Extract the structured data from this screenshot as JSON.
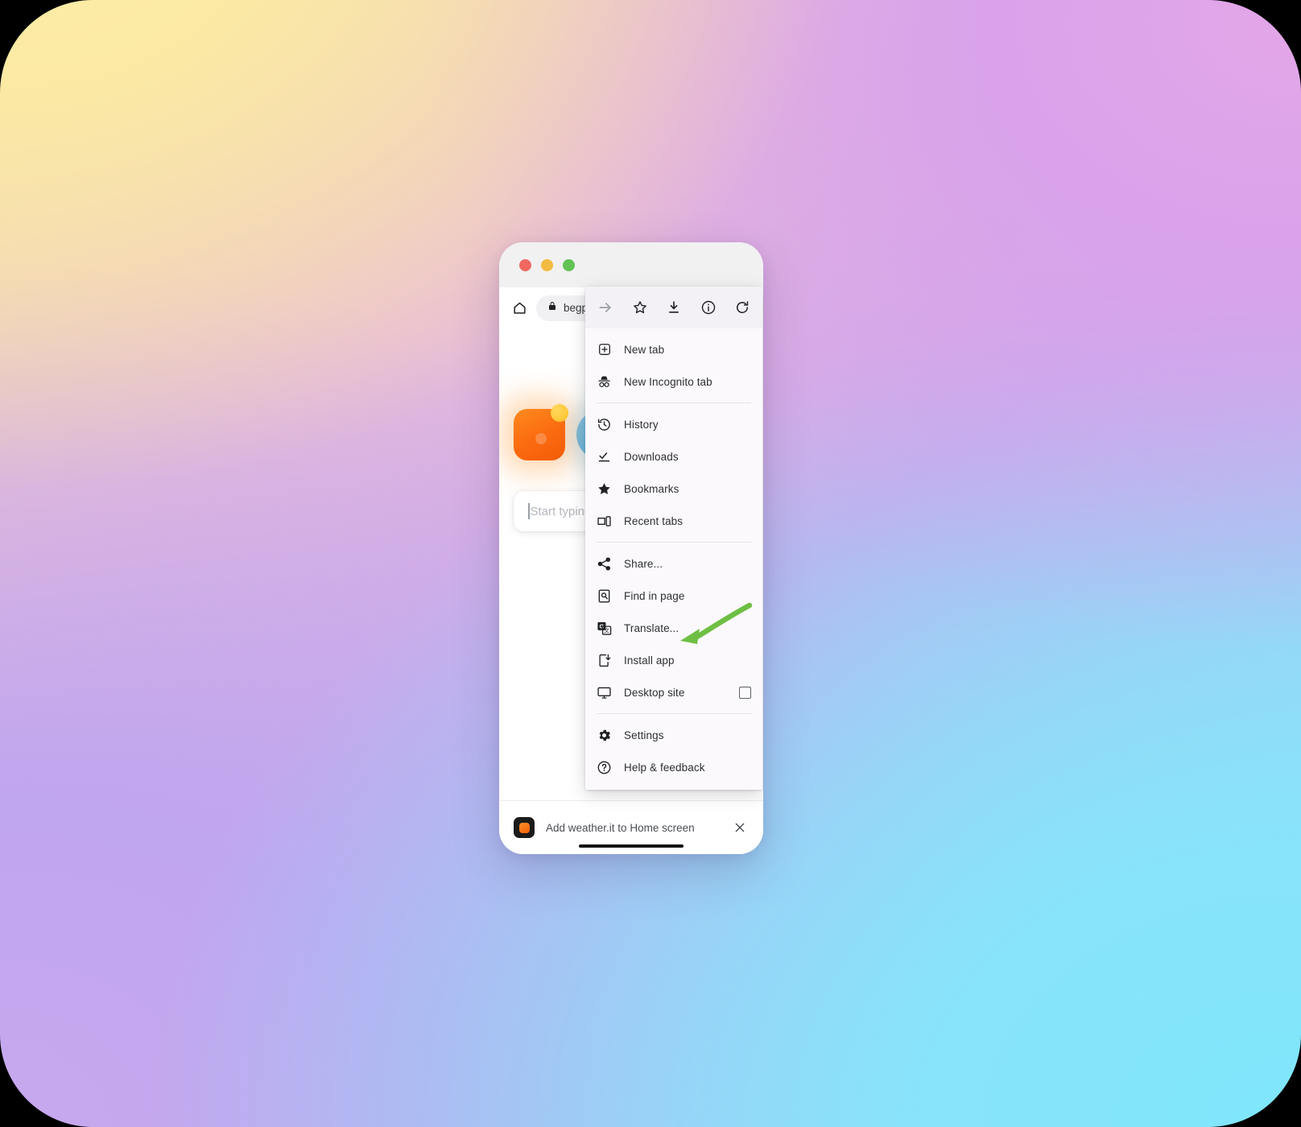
{
  "window": {
    "traffic_lights": [
      "close",
      "minimize",
      "maximize"
    ]
  },
  "browser": {
    "home_icon": "home-icon",
    "url_lock_icon": "lock-icon",
    "url_text": "begpro",
    "toolbar_icons": [
      {
        "name": "forward-icon",
        "label": "Forward",
        "state": "disabled"
      },
      {
        "name": "bookmark-star-icon",
        "label": "Bookmark"
      },
      {
        "name": "download-icon",
        "label": "Downloads"
      },
      {
        "name": "page-info-icon",
        "label": "Page info"
      },
      {
        "name": "reload-icon",
        "label": "Reload"
      }
    ]
  },
  "page": {
    "search_placeholder": "Start typing",
    "tile_orange_color": "#fb6a10",
    "tile_blue_color": "#4fb3f0"
  },
  "menu": {
    "groups": [
      {
        "items": [
          {
            "label": "New tab",
            "icon": "new-tab-icon"
          },
          {
            "label": "New Incognito tab",
            "icon": "incognito-icon"
          }
        ]
      },
      {
        "items": [
          {
            "label": "History",
            "icon": "history-icon"
          },
          {
            "label": "Downloads",
            "icon": "download-check-icon"
          },
          {
            "label": "Bookmarks",
            "icon": "star-filled-icon"
          },
          {
            "label": "Recent tabs",
            "icon": "recent-tabs-icon"
          }
        ]
      },
      {
        "items": [
          {
            "label": "Share...",
            "icon": "share-icon"
          },
          {
            "label": "Find in page",
            "icon": "find-in-page-icon"
          },
          {
            "label": "Translate...",
            "icon": "translate-icon"
          },
          {
            "label": "Install app",
            "icon": "install-app-icon"
          },
          {
            "label": "Desktop site",
            "icon": "desktop-site-icon",
            "checkbox": true,
            "checked": false
          }
        ]
      },
      {
        "items": [
          {
            "label": "Settings",
            "icon": "gear-icon"
          },
          {
            "label": "Help & feedback",
            "icon": "help-circle-icon"
          }
        ]
      }
    ]
  },
  "banner": {
    "text": "Add weather.it to Home screen",
    "close_icon": "close-icon",
    "favicon": "weather-app-favicon"
  },
  "annotation": {
    "type": "arrow",
    "color": "#6fbf44",
    "points_to": "Install app"
  }
}
